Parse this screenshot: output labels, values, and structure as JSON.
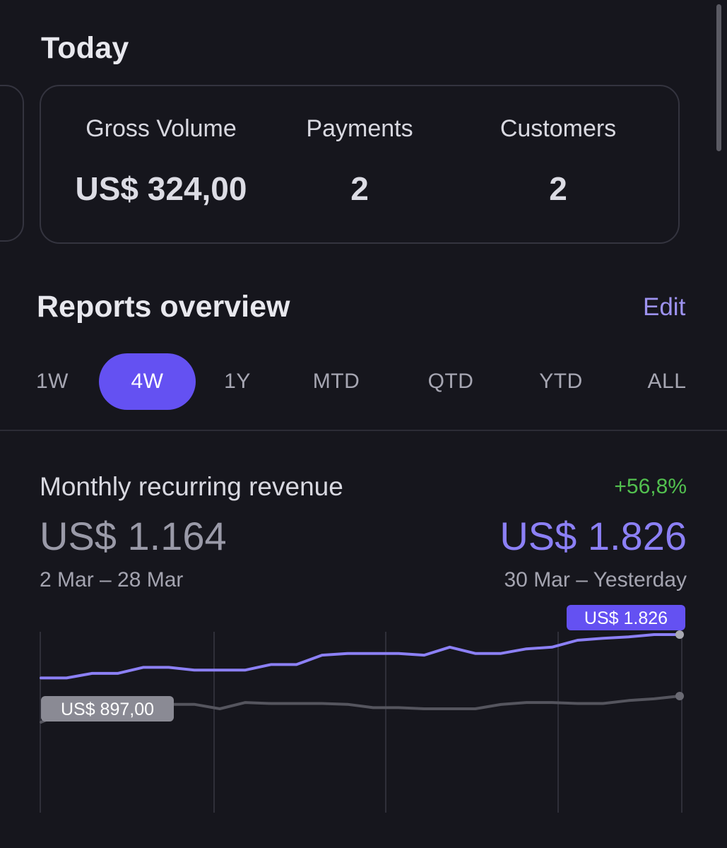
{
  "today": {
    "title": "Today",
    "stats": [
      {
        "label": "Gross Volume",
        "value": "US$ 324,00"
      },
      {
        "label": "Payments",
        "value": "2"
      },
      {
        "label": "Customers",
        "value": "2"
      }
    ]
  },
  "reports": {
    "title": "Reports overview",
    "edit_label": "Edit",
    "tabs": [
      "1W",
      "4W",
      "1Y",
      "MTD",
      "QTD",
      "YTD",
      "ALL"
    ],
    "active_tab": "4W"
  },
  "mrr": {
    "title": "Monthly recurring revenue",
    "change": "+56,8%",
    "previous_value": "US$ 1.164",
    "current_value": "US$ 1.826",
    "previous_range": "2 Mar – 28 Mar",
    "current_range": "30 Mar – Yesterday"
  },
  "colors": {
    "accent": "#6451f2",
    "current_series": "#8c80f6",
    "previous_series": "#55555e",
    "positive": "#52c04f"
  },
  "chart_data": {
    "type": "line",
    "grid": "vertical",
    "series": [
      {
        "key": "current",
        "tooltip": "US$ 1.826",
        "values": [
          1164,
          1164,
          1192,
          1192,
          1228,
          1228,
          1212,
          1212,
          1212,
          1245,
          1245,
          1302,
          1312,
          1312,
          1312,
          1302,
          1350,
          1312,
          1312,
          1340,
          1350,
          1392,
          1404,
          1412,
          1426,
          1426
        ]
      },
      {
        "key": "previous",
        "tooltip": "US$ 897,00",
        "values": [
          897,
          962,
          970,
          985,
          985,
          1005,
          1005,
          978,
          1016,
          1010,
          1010,
          1010,
          1005,
          985,
          985,
          978,
          978,
          978,
          1004,
          1016,
          1016,
          1010,
          1010,
          1028,
          1038,
          1055
        ]
      }
    ]
  }
}
